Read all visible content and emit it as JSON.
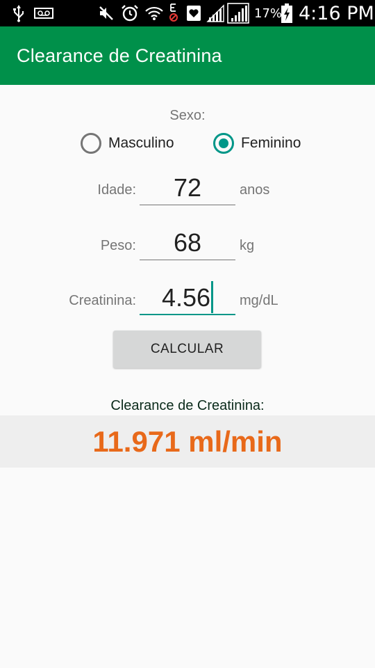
{
  "status_bar": {
    "battery_percent": "17%",
    "time": "4:16 PM"
  },
  "app_bar": {
    "title": "Clearance de Creatinina"
  },
  "form": {
    "sexo_label": "Sexo:",
    "options": [
      {
        "label": "Masculino",
        "checked": false
      },
      {
        "label": "Feminino",
        "checked": true
      }
    ],
    "idade": {
      "label": "Idade:",
      "value": "72",
      "unit": "anos"
    },
    "peso": {
      "label": "Peso:",
      "value": "68",
      "unit": "kg"
    },
    "creatinina": {
      "label": "Creatinina:",
      "value": "4.56",
      "unit": "mg/dL"
    },
    "button_label": "CALCULAR"
  },
  "result": {
    "label": "Clearance de Creatinina:",
    "value": "11.971 ml/min"
  },
  "colors": {
    "app_bar": "#00904a",
    "accent": "#009688",
    "result": "#e8691a"
  }
}
